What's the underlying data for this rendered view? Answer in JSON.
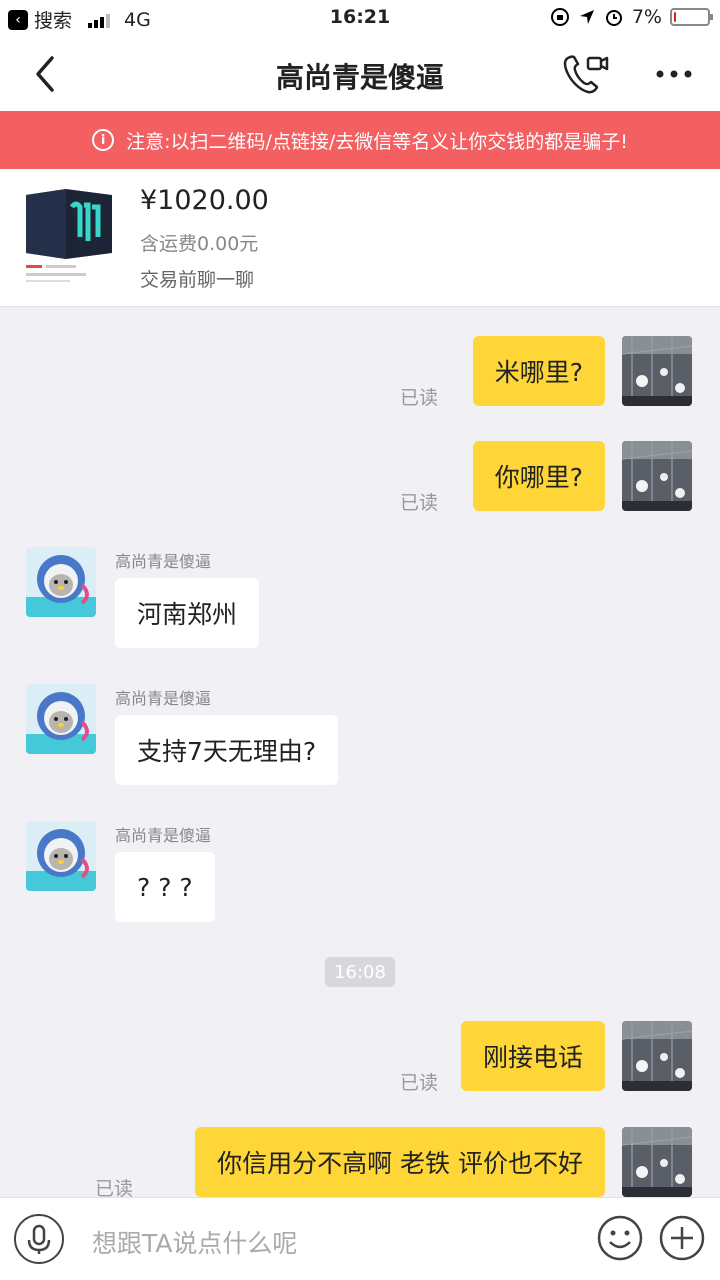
{
  "status_bar": {
    "back_app_label": "搜索",
    "network": "4G",
    "time": "16:21",
    "battery": "7%",
    "battery_level": 0.07
  },
  "header": {
    "title": "高尚青是傻逼"
  },
  "warning": {
    "text": "注意:以扫二维码/点链接/去微信等名义让你交钱的都是骗子!"
  },
  "product": {
    "price": "¥1020.00",
    "shipping": "含运费0.00元",
    "prechat": "交易前聊一聊"
  },
  "messages": {
    "m1": {
      "text": "米哪里?",
      "read": "已读"
    },
    "m2": {
      "text": "你哪里?",
      "read": "已读"
    },
    "m3": {
      "sender": "高尚青是傻逼",
      "text": "河南郑州"
    },
    "m4": {
      "sender": "高尚青是傻逼",
      "text": "支持7天无理由?"
    },
    "m5": {
      "sender": "高尚青是傻逼",
      "text": "? ? ?"
    },
    "time_divider": "16:08",
    "m6": {
      "text": "刚接电话",
      "read": "已读"
    },
    "m7": {
      "text": "你信用分不高啊 老铁  评价也不好",
      "read": "已读"
    }
  },
  "input": {
    "placeholder": "想跟TA说点什么呢"
  },
  "colors": {
    "my_bubble": "#ffd638",
    "warning_bg": "#f45f62",
    "chat_bg": "#f1f1f5"
  }
}
